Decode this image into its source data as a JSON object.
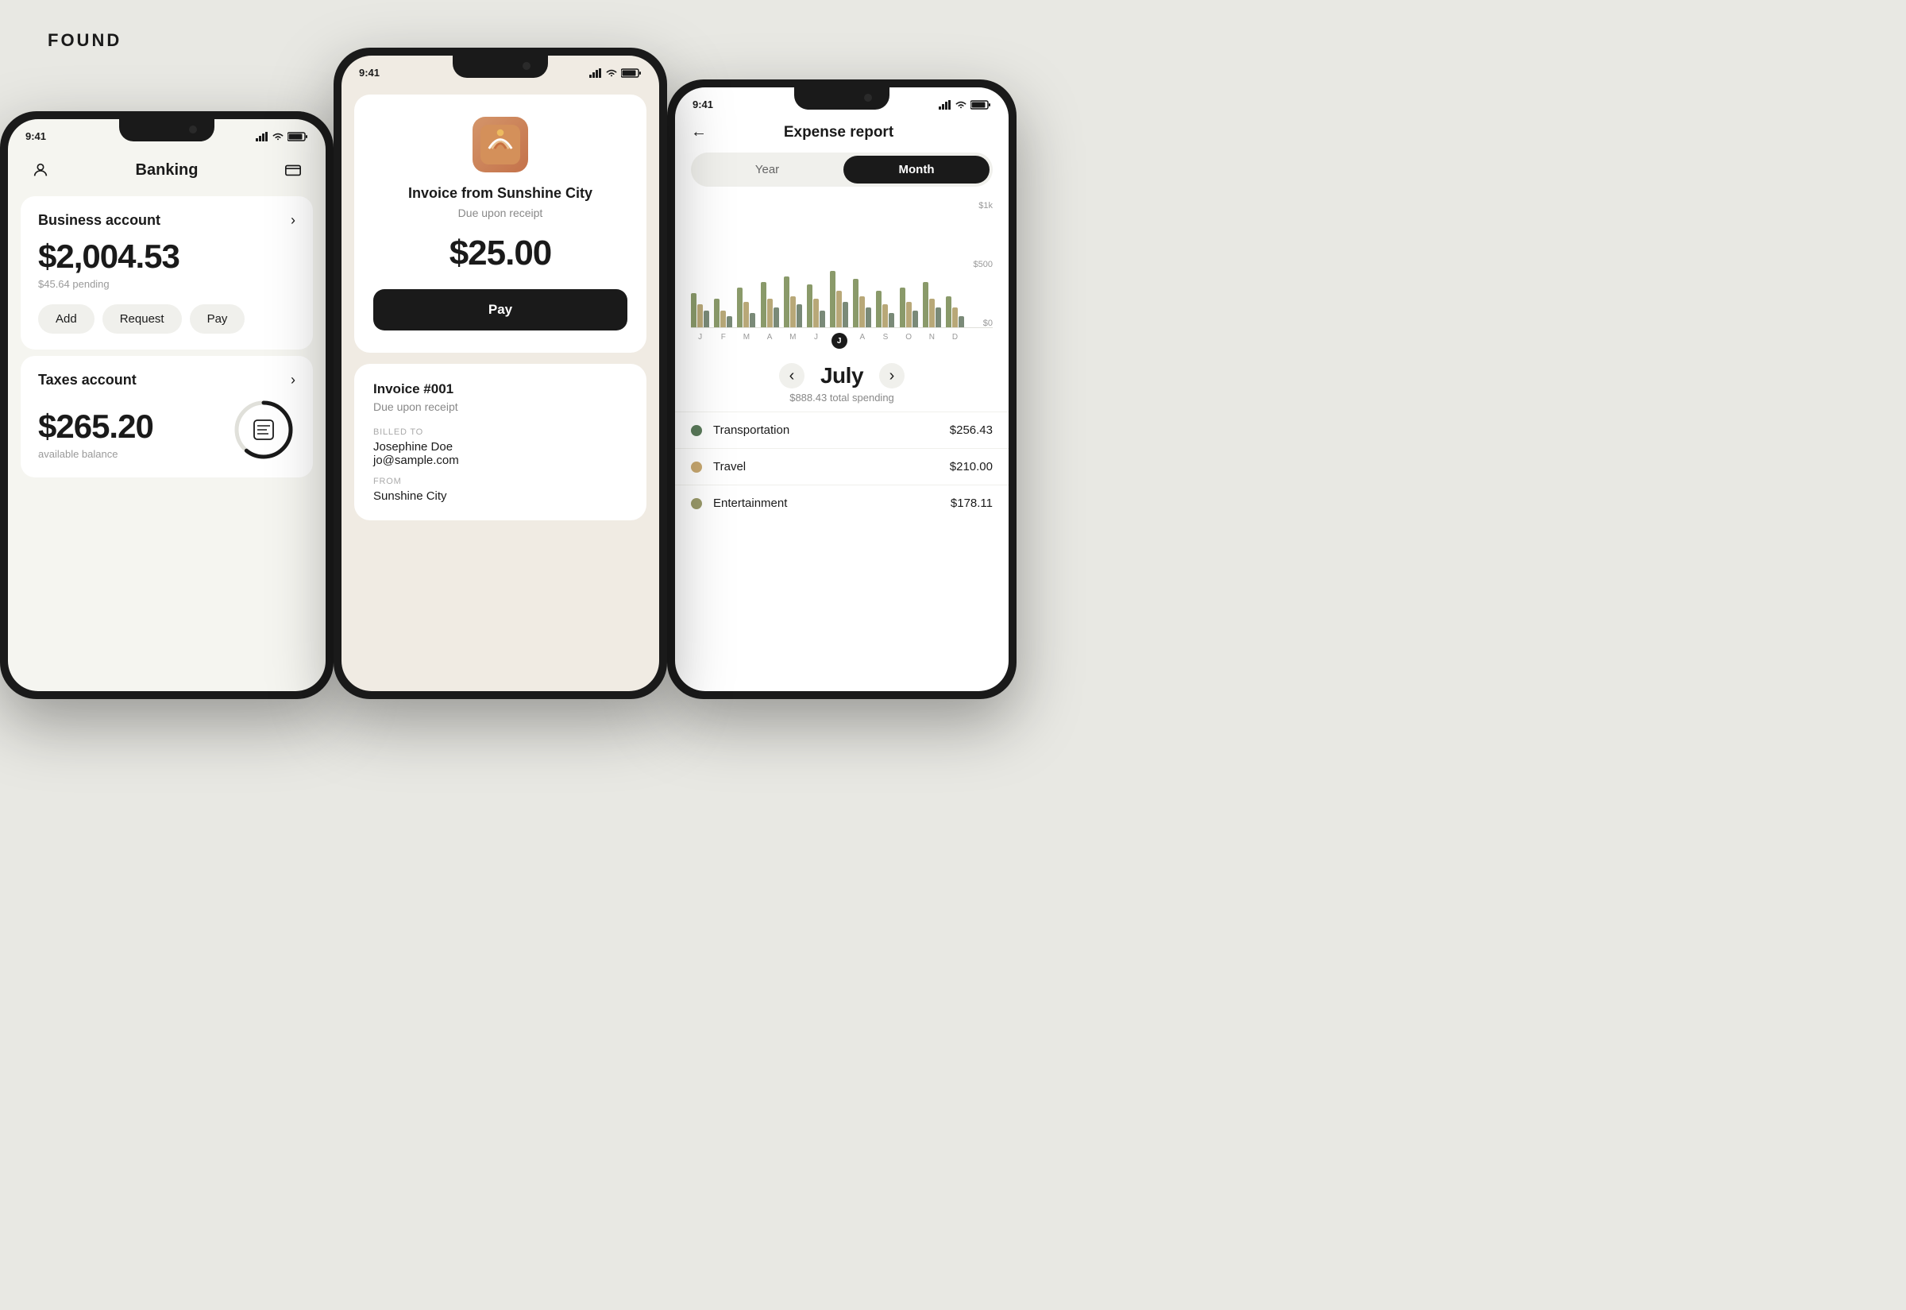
{
  "logo": "FOUND",
  "phone1": {
    "status_time": "9:41",
    "title": "Banking",
    "business_account": {
      "name": "Business account",
      "balance": "$2,004.53",
      "pending": "$45.64 pending",
      "buttons": [
        "Add",
        "Request",
        "Pay"
      ]
    },
    "taxes_account": {
      "name": "Taxes account",
      "balance": "$265.20",
      "available": "available balance"
    }
  },
  "phone2": {
    "status_time": "9:41",
    "invoice_card": {
      "company": "SUNSHINE CITY",
      "title": "Invoice from Sunshine City",
      "due": "Due upon receipt",
      "amount": "$25.00",
      "pay_label": "Pay"
    },
    "invoice_detail": {
      "number": "Invoice #001",
      "due": "Due upon receipt",
      "billed_to_label": "BILLED TO",
      "billed_name": "Josephine Doe",
      "billed_email": "jo@sample.com",
      "from_label": "FROM",
      "from_name": "Sunshine City"
    }
  },
  "phone3": {
    "status_time": "9:41",
    "title": "Expense report",
    "back_label": "←",
    "period": {
      "year_label": "Year",
      "month_label": "Month",
      "active": "month"
    },
    "chart": {
      "y_labels": [
        "$1k",
        "$500",
        "$0"
      ],
      "x_labels": [
        "J",
        "F",
        "M",
        "A",
        "M",
        "J",
        "J",
        "A",
        "S",
        "O",
        "N",
        "D"
      ],
      "active_index": 6,
      "bars": [
        {
          "segments": [
            60,
            40,
            30
          ]
        },
        {
          "segments": [
            50,
            30,
            20
          ]
        },
        {
          "segments": [
            70,
            45,
            25
          ]
        },
        {
          "segments": [
            80,
            50,
            35
          ]
        },
        {
          "segments": [
            90,
            55,
            40
          ]
        },
        {
          "segments": [
            75,
            50,
            30
          ]
        },
        {
          "segments": [
            100,
            65,
            45
          ]
        },
        {
          "segments": [
            85,
            55,
            35
          ]
        },
        {
          "segments": [
            65,
            40,
            25
          ]
        },
        {
          "segments": [
            70,
            45,
            30
          ]
        },
        {
          "segments": [
            80,
            50,
            35
          ]
        },
        {
          "segments": [
            55,
            35,
            20
          ]
        }
      ],
      "colors": [
        "#8a9a6a",
        "#b8a878",
        "#7a8a78"
      ]
    },
    "month_name": "July",
    "month_total": "$888.43 total spending",
    "categories": [
      {
        "name": "Transportation",
        "amount": "$256.43",
        "color": "#5a7a5a"
      },
      {
        "name": "Travel",
        "amount": "$210.00",
        "color": "#c8a870"
      },
      {
        "name": "Entertainment",
        "amount": "$178.11",
        "color": "#9a9a6a"
      }
    ]
  }
}
